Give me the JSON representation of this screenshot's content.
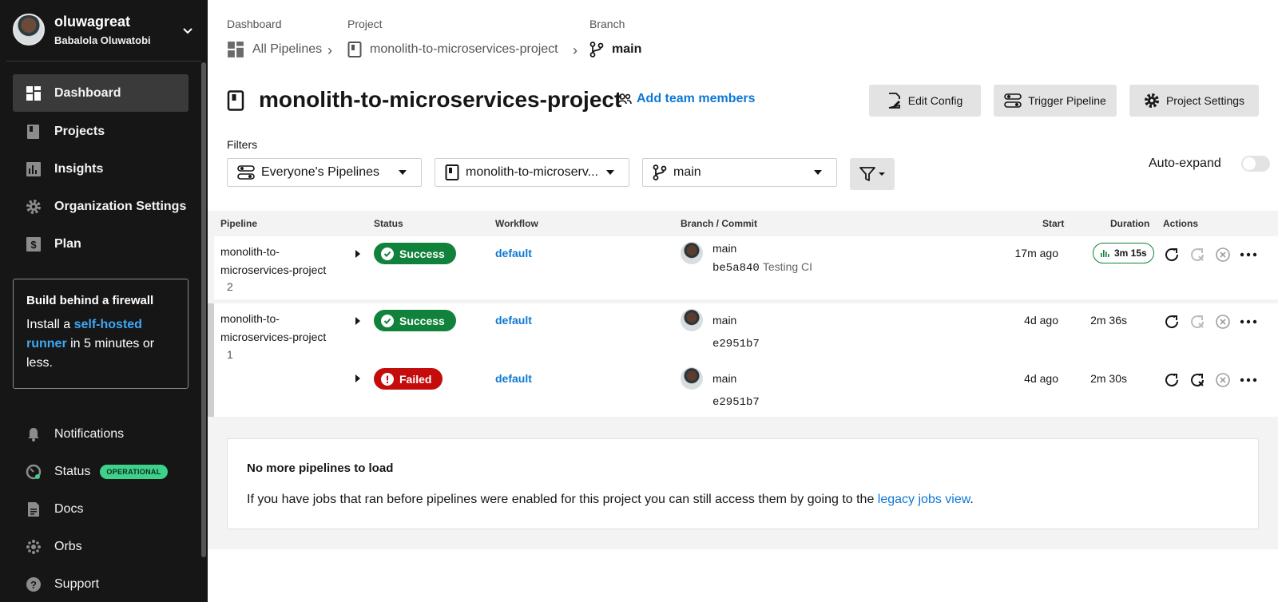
{
  "user": {
    "username": "oluwagreat",
    "full_name": "Babalola Oluwatobi"
  },
  "sidebar": {
    "items": [
      {
        "label": "Dashboard",
        "icon": "dashboard-icon",
        "active": true
      },
      {
        "label": "Projects",
        "icon": "project-icon"
      },
      {
        "label": "Insights",
        "icon": "insights-icon"
      },
      {
        "label": "Organization Settings",
        "icon": "gear-icon"
      },
      {
        "label": "Plan",
        "icon": "dollar-icon"
      }
    ],
    "promo": {
      "title": "Build behind a firewall",
      "text_before": "Install a ",
      "link": "self-hosted runner",
      "text_after": " in 5 minutes or less."
    },
    "bottom_items": [
      {
        "label": "Notifications",
        "icon": "bell-icon"
      },
      {
        "label": "Status",
        "icon": "status-gauge-icon",
        "badge": "OPERATIONAL"
      },
      {
        "label": "Docs",
        "icon": "docs-icon"
      },
      {
        "label": "Orbs",
        "icon": "orbs-icon"
      },
      {
        "label": "Support",
        "icon": "help-icon"
      }
    ]
  },
  "breadcrumb": {
    "dashboard_label": "Dashboard",
    "project_label": "Project",
    "branch_label": "Branch",
    "all_pipelines": "All Pipelines",
    "project": "monolith-to-microservices-project",
    "branch": "main"
  },
  "header": {
    "title": "monolith-to-microservices-project",
    "add_team": "Add team members",
    "edit_config": "Edit Config",
    "trigger_pipeline": "Trigger Pipeline",
    "project_settings": "Project Settings"
  },
  "filters": {
    "label": "Filters",
    "pipelines": "Everyone's Pipelines",
    "project": "monolith-to-microserv...",
    "branch": "main",
    "auto_expand": "Auto-expand",
    "auto_expand_on": false
  },
  "table": {
    "headers": {
      "pipeline": "Pipeline",
      "status": "Status",
      "workflow": "Workflow",
      "branch_commit": "Branch / Commit",
      "start": "Start",
      "duration": "Duration",
      "actions": "Actions"
    },
    "rows": [
      {
        "pipeline": "monolith-to-microservices-project",
        "number": "2",
        "status": "Success",
        "workflow": "default",
        "branch": "main",
        "commit": "be5a840",
        "message": "Testing CI",
        "start": "17m ago",
        "duration": "3m 15s"
      },
      {
        "pipeline": "monolith-to-microservices-project",
        "number": "1",
        "status": "Success",
        "workflow": "default",
        "branch": "main",
        "commit": "e2951b7",
        "message": "",
        "start": "4d ago",
        "duration": "2m 36s"
      },
      {
        "pipeline": "",
        "number": "",
        "status": "Failed",
        "workflow": "default",
        "branch": "main",
        "commit": "e2951b7",
        "message": "",
        "start": "4d ago",
        "duration": "2m 30s"
      }
    ]
  },
  "footer": {
    "title": "No more pipelines to load",
    "text": "If you have jobs that ran before pipelines were enabled for this project you can still access them by going to the ",
    "link": "legacy jobs view",
    "text_end": "."
  },
  "colors": {
    "sidebar": "#161616",
    "success": "#11823b",
    "failed": "#c40c0c",
    "link": "#0d78d3",
    "accent_link": "#3fa7f5"
  }
}
